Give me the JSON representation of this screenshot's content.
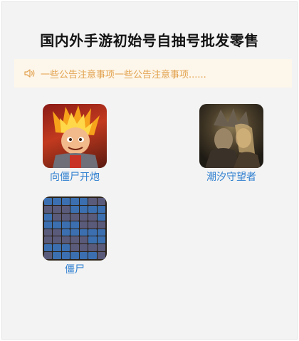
{
  "header": {
    "title": "国内外手游初始号自抽号批发零售"
  },
  "notice": {
    "icon": "speaker-icon",
    "text": "一些公告注意事项一些公告注意事项......",
    "color": "#e2a24f"
  },
  "games": [
    {
      "name": "向僵尸开炮",
      "icon": "cartoon-hero-game-icon"
    },
    {
      "name": "潮汐守望者",
      "icon": "dark-warrior-game-icon"
    },
    {
      "name": "僵尸",
      "icon": "item-grid-game-icon"
    }
  ],
  "colors": {
    "link": "#2f7fd0",
    "notice_bg": "#fdf6ea",
    "page_bg": "#f3f3f3"
  }
}
